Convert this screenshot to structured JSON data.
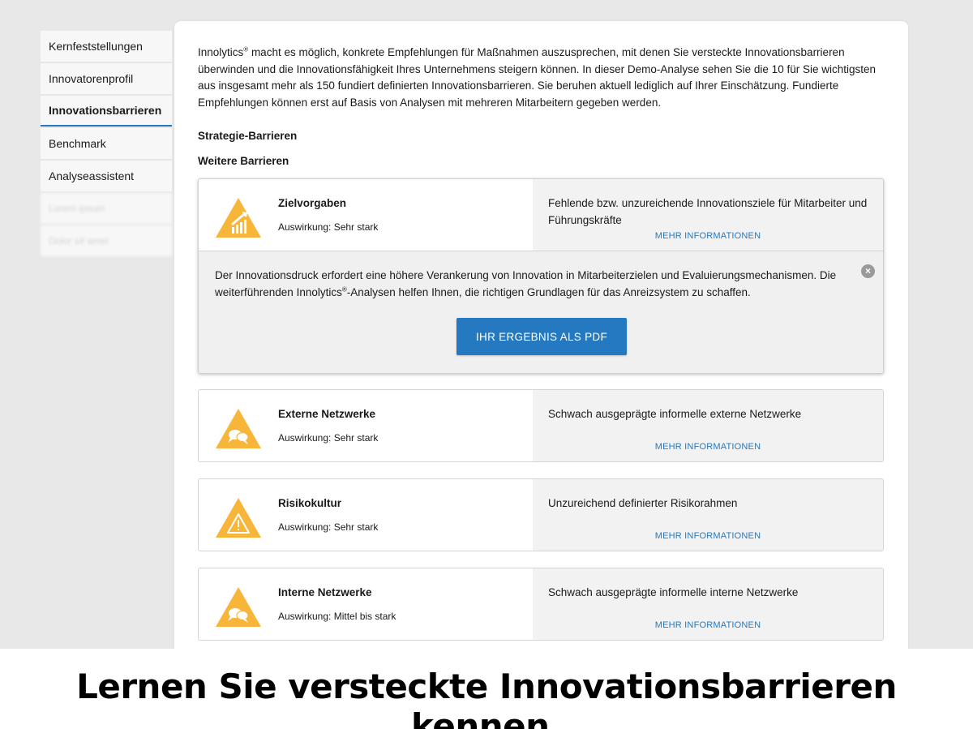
{
  "sidebar": {
    "items": [
      {
        "label": "Kernfeststellungen"
      },
      {
        "label": "Innovatorenprofil"
      },
      {
        "label": "Innovationsbarrieren"
      },
      {
        "label": "Benchmark"
      },
      {
        "label": "Analyseassistent"
      },
      {
        "label": "Lorem ipsum"
      },
      {
        "label": "Dolor sit amet"
      }
    ]
  },
  "intro": {
    "brand": "Innolytics",
    "reg": "®",
    "text": " macht es möglich, konkrete Empfehlungen für Maßnahmen auszusprechen, mit denen Sie versteckte Innovationsbarrieren überwinden und die Innovationsfähigkeit Ihres Unternehmens steigern können. In dieser Demo-Analyse sehen Sie die 10 für Sie wichtigsten aus insgesamt mehr als 150 fundiert definierten Innovationsbarrieren. Sie beruhen aktuell lediglich auf Ihrer Einschätzung. Fundierte Empfehlungen können erst auf Basis von Analysen mit mehreren Mitarbeitern gegeben werden."
  },
  "sections": {
    "strategy": "Strategie-Barrieren",
    "further": "Weitere Barrieren"
  },
  "cards": [
    {
      "title": "Zielvorgaben",
      "impact": "Auswirkung: Sehr stark",
      "desc": "Fehlende bzw. unzureichende Innovationsziele für Mitarbeiter und Führungskräfte",
      "more": "MEHR INFORMATIONEN",
      "icon": "growth-people-icon"
    },
    {
      "title": "Externe Netzwerke",
      "impact": "Auswirkung: Sehr stark",
      "desc": "Schwach ausgeprägte informelle externe Netzwerke",
      "more": "MEHR INFORMATIONEN",
      "icon": "chat-bubbles-icon"
    },
    {
      "title": "Risikokultur",
      "impact": "Auswirkung: Sehr stark",
      "desc": "Unzureichend definierter Risikorahmen",
      "more": "MEHR INFORMATIONEN",
      "icon": "warning-icon"
    },
    {
      "title": "Interne Netzwerke",
      "impact": "Auswirkung: Mittel bis stark",
      "desc": "Schwach ausgeprägte informelle interne Netzwerke",
      "more": "MEHR INFORMATIONEN",
      "icon": "chat-bubbles-icon"
    }
  ],
  "expanded": {
    "text_a": "Der Innovationsdruck erfordert eine höhere Verankerung von Innovation in Mitarbeiterzielen und Evaluierungsmechanismen. Die weiterführenden Innolytics",
    "reg": "®",
    "text_b": "-Analysen helfen Ihnen, die richtigen Grundlagen für das Anreizsystem zu schaffen.",
    "close": "×",
    "button": "IHR ERGEBNIS ALS PDF"
  },
  "colors": {
    "accent": "#2479c0",
    "warning_triangle": "#f7b53a"
  },
  "caption": "Lernen Sie versteckte Innovationsbarrieren kennen."
}
